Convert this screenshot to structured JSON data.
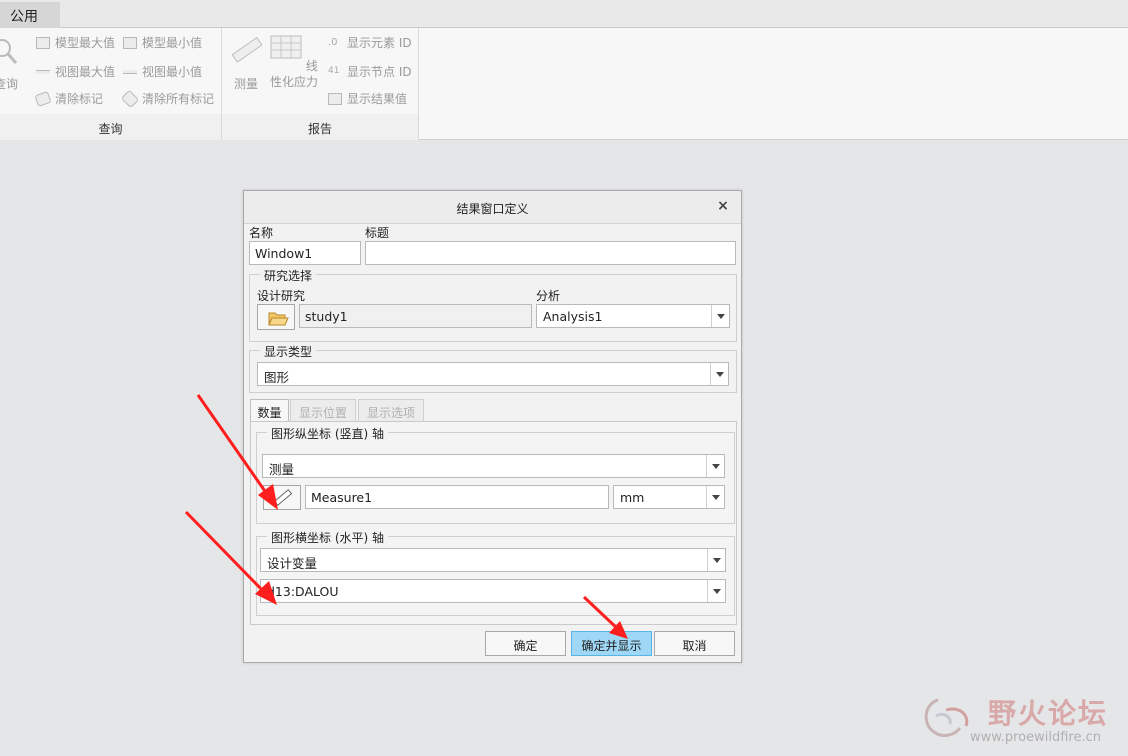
{
  "tabstrip": {
    "active_tab": "公用"
  },
  "ribbon": {
    "query_group": {
      "label": "查询",
      "partial_button": "查询",
      "items": [
        "模型最大值",
        "模型最小值",
        "视图最大值",
        "视图最小值",
        "清除标记",
        "清除所有标记"
      ]
    },
    "report_group": {
      "label": "报告",
      "measure_button": "测量",
      "linearize_button": "线性化应力",
      "items": [
        "显示元素 ID",
        "显示节点 ID",
        "显示结果值"
      ]
    }
  },
  "dialog": {
    "title": "结果窗口定义",
    "close": "×",
    "name_label": "名称",
    "name_value": "Window1",
    "title_label": "标题",
    "title_value": "",
    "study_section": {
      "legend": "研究选择",
      "design_study_label": "设计研究",
      "design_study_value": "study1",
      "analysis_label": "分析",
      "analysis_value": "Analysis1"
    },
    "display_type": {
      "legend": "显示类型",
      "value": "图形"
    },
    "tabs": [
      {
        "label": "数量",
        "state": "active"
      },
      {
        "label": "显示位置",
        "state": "disabled"
      },
      {
        "label": "显示选项",
        "state": "disabled"
      }
    ],
    "y_axis": {
      "legend": "图形纵坐标 (竖直) 轴",
      "quantity": "测量",
      "measure_name": "Measure1",
      "unit": "mm"
    },
    "x_axis": {
      "legend": "图形横坐标 (水平) 轴",
      "type": "设计变量",
      "variable": "d13:DALOU"
    },
    "buttons": {
      "ok": "确定",
      "ok_show": "确定并显示",
      "cancel": "取消"
    }
  },
  "annotation_color": "#ff1e1e",
  "watermark": {
    "name": "野火论坛",
    "url": "www.proewildfire.cn"
  }
}
